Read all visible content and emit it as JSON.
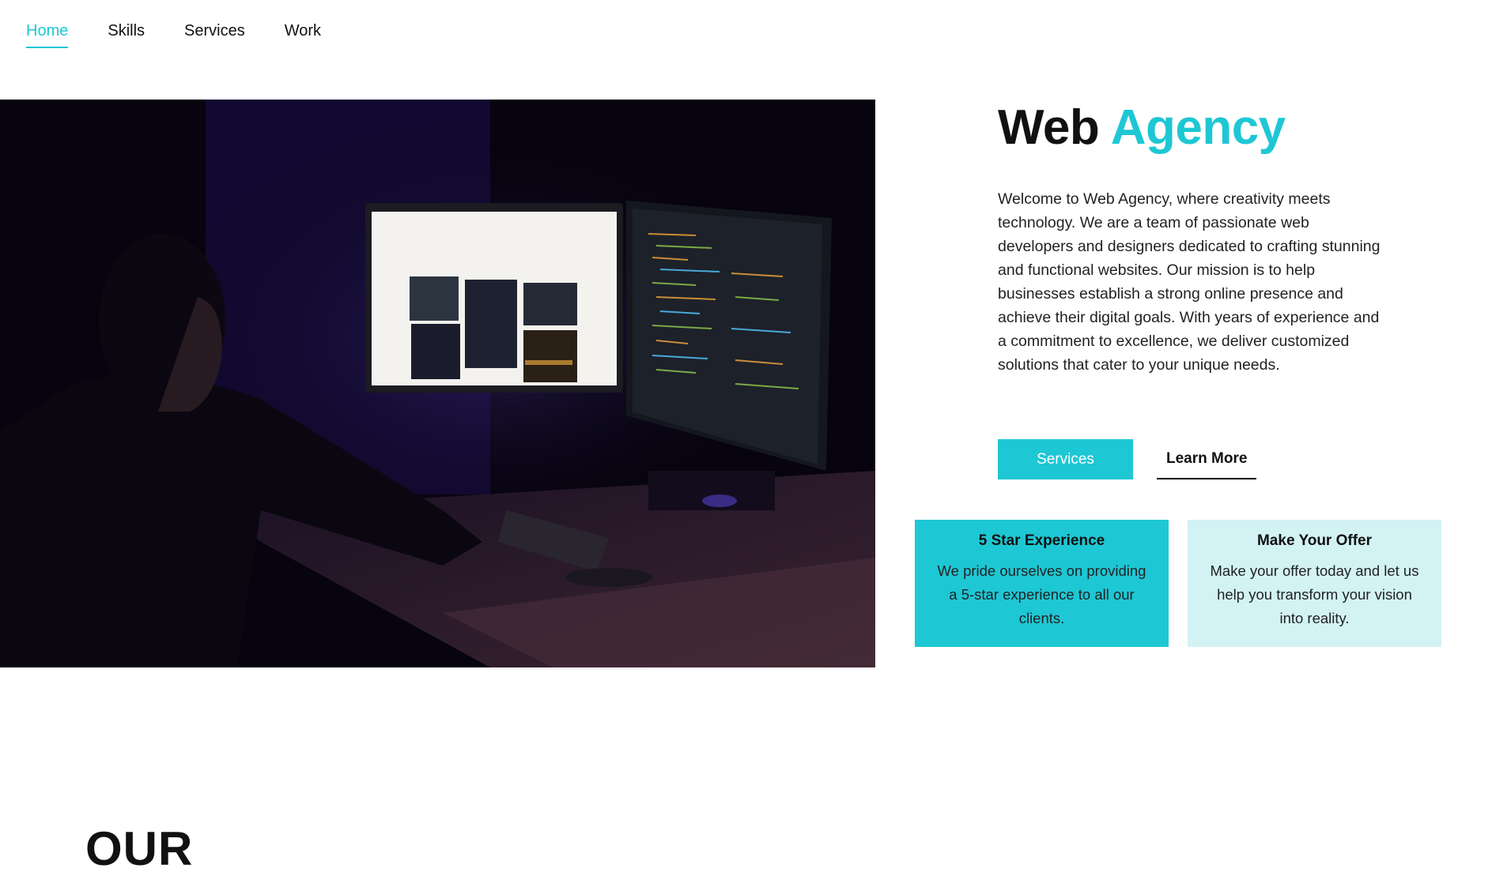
{
  "nav": {
    "items": [
      {
        "label": "Home",
        "active": true
      },
      {
        "label": "Skills",
        "active": false
      },
      {
        "label": "Services",
        "active": false
      },
      {
        "label": "Work",
        "active": false
      }
    ]
  },
  "hero": {
    "title_main": "Web",
    "title_accent": "Agency",
    "intro": "Welcome to Web Agency, where creativity meets technology. We are a team of passionate web developers and designers dedicated to crafting stunning and functional websites. Our mission is to help businesses establish a strong online presence and achieve their digital goals. With years of experience and a commitment to excellence, we deliver customized solutions that cater to your unique needs.",
    "primary_button": "Services",
    "secondary_button": "Learn More"
  },
  "cards": [
    {
      "title": "5 Star Experience",
      "text": "We pride ourselves on providing a 5-star experience to all our clients."
    },
    {
      "title": "Make Your Offer",
      "text": "Make your offer today and let us help you transform your vision into reality."
    }
  ],
  "next_section": {
    "heading": "OUR"
  },
  "colors": {
    "accent": "#1ec7d4",
    "card_light": "#d3f2f4"
  }
}
